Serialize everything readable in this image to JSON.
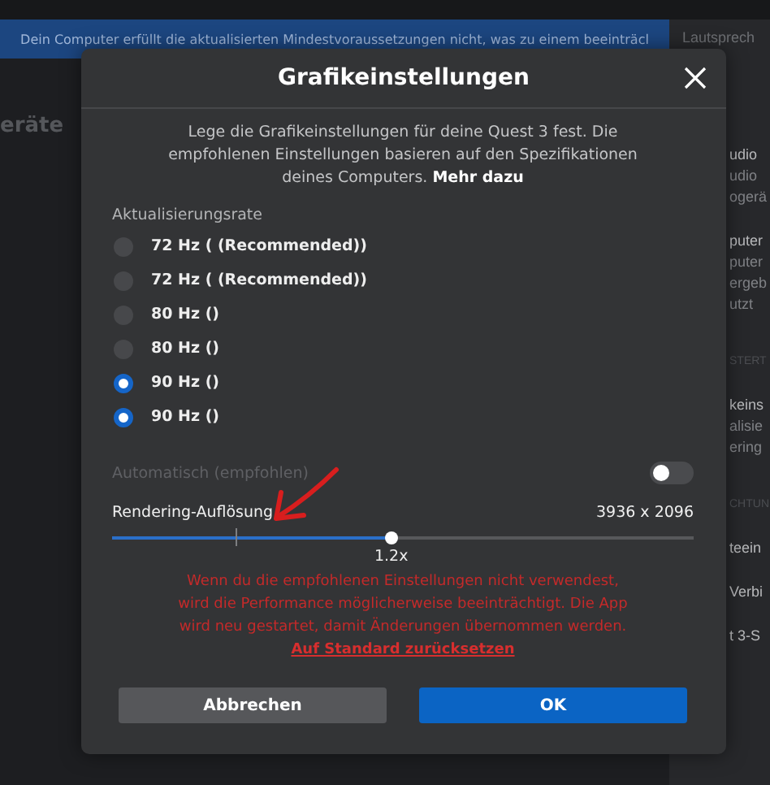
{
  "banner": {
    "text": "Dein Computer erfüllt die aktualisierten Mindestvoraussetzungen nicht, was zu einem beeinträcl"
  },
  "background": {
    "left_heading": "eräte",
    "right_panel": [
      {
        "text": "Lautsprech",
        "kind": "tab"
      },
      {
        "text": "udio",
        "kind": "strong"
      },
      {
        "text": "udio",
        "kind": "muted"
      },
      {
        "text": "ogerä",
        "kind": "muted"
      },
      {
        "text": "puter",
        "kind": "strong"
      },
      {
        "text": "puter",
        "kind": "muted"
      },
      {
        "text": "ergeb",
        "kind": "muted"
      },
      {
        "text": "utzt",
        "kind": "muted"
      },
      {
        "text": "STERT",
        "kind": "section"
      },
      {
        "text": "keins",
        "kind": "strong"
      },
      {
        "text": "alisie",
        "kind": "muted"
      },
      {
        "text": "ering",
        "kind": "muted"
      },
      {
        "text": "CHTUN",
        "kind": "section"
      },
      {
        "text": "teein",
        "kind": "strong"
      },
      {
        "text": "Verbi",
        "kind": "strong"
      },
      {
        "text": "t 3-S",
        "kind": "strong"
      }
    ]
  },
  "dialog": {
    "title": "Grafikeinstellungen",
    "description": "Lege die Grafikeinstellungen für deine Quest 3 fest. Die empfohlenen Einstellungen basieren auf den Spezifikationen deines Computers.",
    "description_link": "Mehr dazu",
    "refresh_label": "Aktualisierungsrate",
    "refresh_options": [
      {
        "label": "72 Hz ( (Recommended))",
        "selected": false
      },
      {
        "label": "72 Hz ( (Recommended))",
        "selected": false
      },
      {
        "label": "80 Hz ()",
        "selected": false
      },
      {
        "label": "80 Hz ()",
        "selected": false
      },
      {
        "label": "90 Hz ()",
        "selected": true
      },
      {
        "label": "90 Hz ()",
        "selected": true
      }
    ],
    "auto": {
      "label": "Automatisch (empfohlen)",
      "on": false
    },
    "resolution": {
      "label": "Rendering-Auflösung",
      "reading": "3936 x 2096",
      "level": 0.48,
      "value_label": "1.2x"
    },
    "warning": "Wenn du die empfohlenen Einstellungen nicht verwendest, wird die Performance möglicherweise beeinträchtigt. Die App wird neu gestartet, damit Änderungen übernommen werden.",
    "warning_link": "Auf Standard zurücksetzen",
    "buttons": [
      {
        "label": "Abbrechen",
        "kind": "secondary"
      },
      {
        "label": "OK",
        "kind": "primary"
      }
    ]
  }
}
